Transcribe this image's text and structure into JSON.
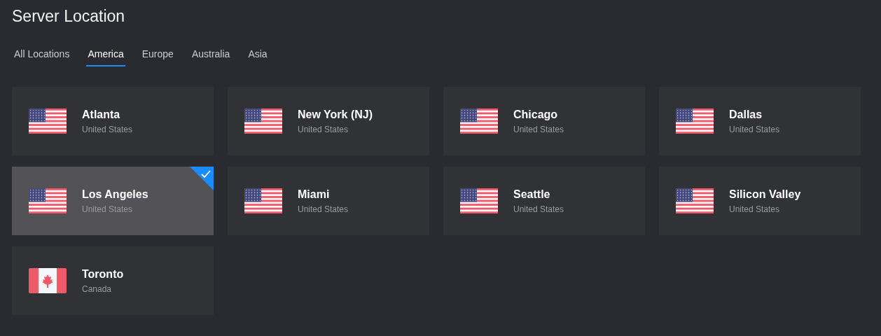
{
  "title": "Server Location",
  "tabs": [
    {
      "label": "All Locations",
      "selected": false
    },
    {
      "label": "America",
      "selected": true
    },
    {
      "label": "Europe",
      "selected": false
    },
    {
      "label": "Australia",
      "selected": false
    },
    {
      "label": "Asia",
      "selected": false
    }
  ],
  "locations": [
    {
      "city": "Atlanta",
      "country": "United States",
      "kind": "us",
      "selected": false
    },
    {
      "city": "New York (NJ)",
      "country": "United States",
      "kind": "us",
      "selected": false
    },
    {
      "city": "Chicago",
      "country": "United States",
      "kind": "us",
      "selected": false
    },
    {
      "city": "Dallas",
      "country": "United States",
      "kind": "us",
      "selected": false
    },
    {
      "city": "Los Angeles",
      "country": "United States",
      "kind": "us",
      "selected": true
    },
    {
      "city": "Miami",
      "country": "United States",
      "kind": "us",
      "selected": false
    },
    {
      "city": "Seattle",
      "country": "United States",
      "kind": "us",
      "selected": false
    },
    {
      "city": "Silicon Valley",
      "country": "United States",
      "kind": "us",
      "selected": false
    },
    {
      "city": "Toronto",
      "country": "Canada",
      "kind": "ca",
      "selected": false
    }
  ]
}
